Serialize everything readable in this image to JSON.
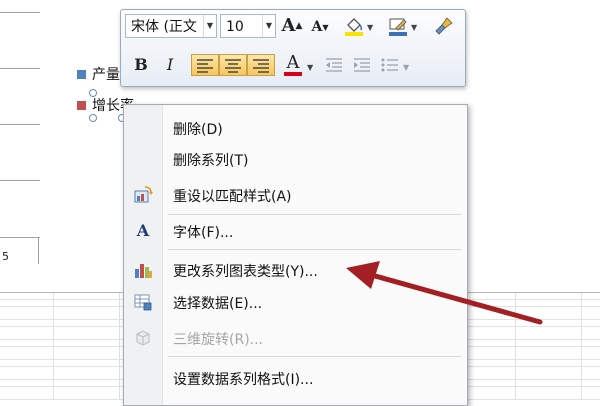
{
  "chart": {
    "axis_value": "5",
    "legend": [
      {
        "label": "产量",
        "color": "#4f81bd"
      },
      {
        "label": "增长率",
        "color": "#c0504d"
      }
    ]
  },
  "mini_toolbar": {
    "font_name": "宋体 (正文",
    "font_size": "10",
    "buttons": {
      "grow_font": "A",
      "shrink_font": "A",
      "bold": "B",
      "italic": "I",
      "font_color": "A"
    },
    "colors": {
      "font_color_underline": "#d9001b",
      "fill_color_underline": "#f6e400",
      "outline_color_underline": "#3b6fb6"
    }
  },
  "context_menu": {
    "items": [
      {
        "label": "删除(D)",
        "icon": "none",
        "disabled": false
      },
      {
        "label": "删除系列(T)",
        "icon": "none",
        "disabled": false
      },
      {
        "label": "重设以匹配样式(A)",
        "icon": "reset-style-icon",
        "disabled": false
      },
      {
        "label": "字体(F)...",
        "icon": "font-icon",
        "disabled": false
      },
      {
        "label": "更改系列图表类型(Y)...",
        "icon": "chart-type-icon",
        "disabled": false
      },
      {
        "label": "选择数据(E)...",
        "icon": "select-data-icon",
        "disabled": false
      },
      {
        "label": "三维旋转(R)...",
        "icon": "3d-rotation-icon",
        "disabled": true
      },
      {
        "label": "设置数据系列格式(I)...",
        "icon": "none",
        "disabled": false
      }
    ],
    "font_icon_glyph": "A"
  },
  "annotation": {
    "arrow_color": "#a31f24"
  }
}
